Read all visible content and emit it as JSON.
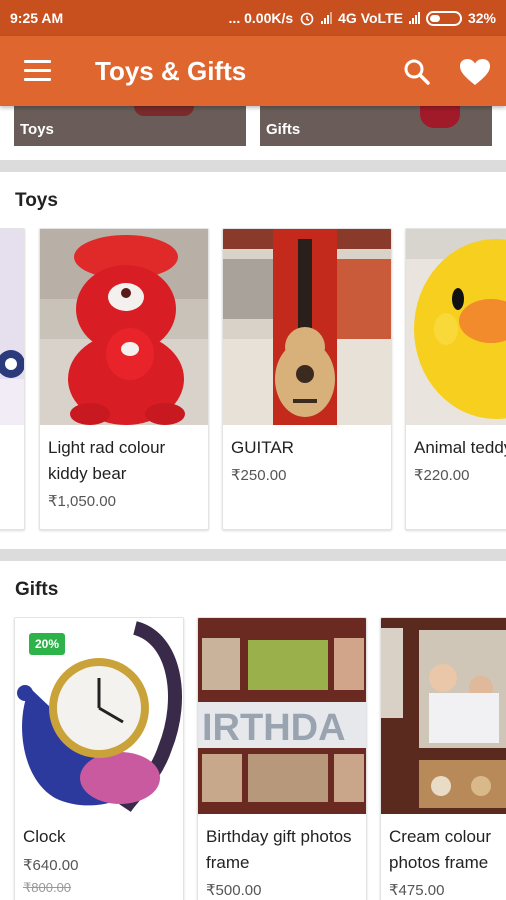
{
  "status_bar": {
    "time": "9:25 AM",
    "network_speed": "... 0.00K/s",
    "network_type": "4G VoLTE",
    "battery": "32%"
  },
  "app_bar": {
    "menu_icon": "menu-icon",
    "title": "Toys & Gifts",
    "search_icon": "search-icon",
    "favorites_icon": "heart-icon",
    "color": "#e0662f"
  },
  "banners": [
    {
      "label": "Toys"
    },
    {
      "label": "Gifts"
    }
  ],
  "sections": [
    {
      "title": "Toys",
      "products": [
        {
          "name": "",
          "price": ""
        },
        {
          "name": "Light rad colour kiddy bear",
          "price": "₹1,050.00"
        },
        {
          "name": "GUITAR",
          "price": "₹250.00"
        },
        {
          "name": "Animal teddy",
          "price": "₹220.00"
        }
      ]
    },
    {
      "title": "Gifts",
      "products": [
        {
          "name": "Clock",
          "price": "₹640.00",
          "old_price": "₹800.00",
          "discount": "20%"
        },
        {
          "name": "Birthday gift photos frame",
          "price": "₹500.00"
        },
        {
          "name": "Cream colour photos frame",
          "price": "₹475.00"
        }
      ]
    }
  ]
}
